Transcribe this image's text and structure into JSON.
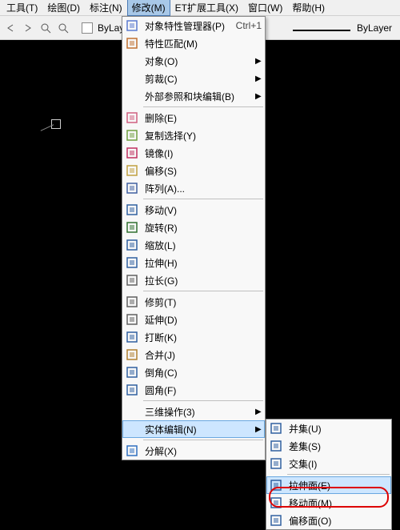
{
  "menubar": {
    "items": [
      {
        "label": "工具(T)"
      },
      {
        "label": "绘图(D)"
      },
      {
        "label": "标注(N)"
      },
      {
        "label": "修改(M)",
        "active": true
      },
      {
        "label": "ET扩展工具(X)"
      },
      {
        "label": "窗口(W)"
      },
      {
        "label": "帮助(H)"
      }
    ]
  },
  "toolbar": {
    "layer_label": "ByLayer",
    "linetype_label": "ByLayer"
  },
  "modify_menu": [
    {
      "icon": "properties-icon",
      "label": "对象特性管理器(P)",
      "accel": "Ctrl+1"
    },
    {
      "icon": "match-icon",
      "label": "特性匹配(M)"
    },
    {
      "label": "对象(O)",
      "submenu": true
    },
    {
      "label": "剪裁(C)",
      "submenu": true
    },
    {
      "label": "外部参照和块编辑(B)",
      "submenu": true
    },
    {
      "sep": true
    },
    {
      "icon": "erase-icon",
      "label": "删除(E)"
    },
    {
      "icon": "copy-icon",
      "label": "复制选择(Y)"
    },
    {
      "icon": "mirror-icon",
      "label": "镜像(I)"
    },
    {
      "icon": "offset-icon",
      "label": "偏移(S)"
    },
    {
      "icon": "array-icon",
      "label": "阵列(A)..."
    },
    {
      "sep": true
    },
    {
      "icon": "move-icon",
      "label": "移动(V)"
    },
    {
      "icon": "rotate-icon",
      "label": "旋转(R)"
    },
    {
      "icon": "scale-icon",
      "label": "缩放(L)"
    },
    {
      "icon": "stretch-icon",
      "label": "拉伸(H)"
    },
    {
      "icon": "lengthen-icon",
      "label": "拉长(G)"
    },
    {
      "sep": true
    },
    {
      "icon": "trim-icon",
      "label": "修剪(T)"
    },
    {
      "icon": "extend-icon",
      "label": "延伸(D)"
    },
    {
      "icon": "break-icon",
      "label": "打断(K)"
    },
    {
      "icon": "join-icon",
      "label": "合并(J)"
    },
    {
      "icon": "chamfer-icon",
      "label": "倒角(C)"
    },
    {
      "icon": "fillet-icon",
      "label": "圆角(F)"
    },
    {
      "sep": true
    },
    {
      "label": "三维操作(3)",
      "submenu": true
    },
    {
      "label": "实体编辑(N)",
      "submenu": true,
      "hover": true
    },
    {
      "sep": true
    },
    {
      "icon": "explode-icon",
      "label": "分解(X)"
    }
  ],
  "solid_edit_submenu": [
    {
      "icon": "union-icon",
      "label": "并集(U)"
    },
    {
      "icon": "subtract-icon",
      "label": "差集(S)"
    },
    {
      "icon": "intersect-icon",
      "label": "交集(I)"
    },
    {
      "sep": true
    },
    {
      "icon": "extrude-face-icon",
      "label": "拉伸面(E)",
      "hover": true,
      "ring": true
    },
    {
      "icon": "move-face-icon",
      "label": "移动面(M)"
    },
    {
      "icon": "offset-face-icon",
      "label": "偏移面(O)"
    }
  ]
}
